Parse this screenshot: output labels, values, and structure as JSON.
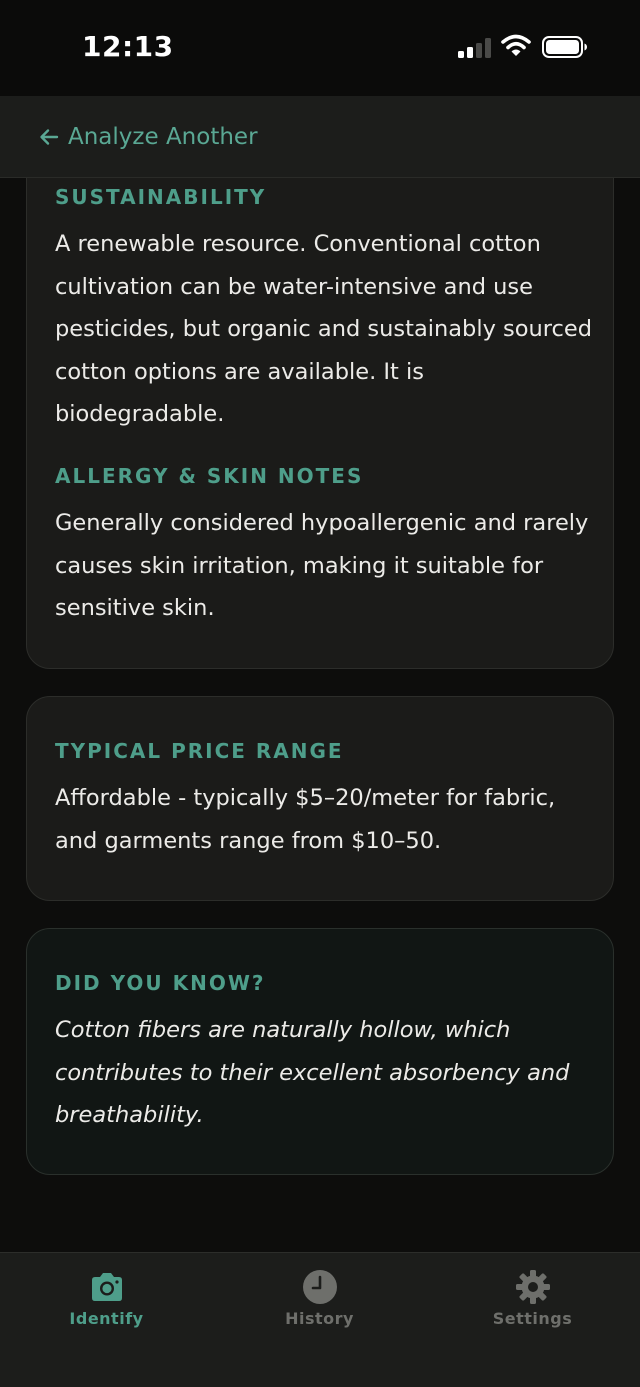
{
  "status_bar": {
    "time": "12:13"
  },
  "header": {
    "back_label": "Analyze Another"
  },
  "sections": {
    "sustainability": {
      "title": "SUSTAINABILITY",
      "lines": [
        "A renewable resource. Conventional cotton",
        "cultivation can be water-intensive and use",
        "pesticides, but organic and sustainably sourced",
        "cotton options are available. It is",
        "biodegradable."
      ]
    },
    "allergy": {
      "title": "ALLERGY & SKIN NOTES",
      "lines": [
        "Generally considered hypoallergenic and rarely",
        "causes skin irritation, making it suitable for",
        "sensitive skin."
      ]
    },
    "price": {
      "title": "TYPICAL PRICE RANGE",
      "lines": [
        "Affordable - typically $5–20/meter for fabric,",
        "and garments range from $10–50."
      ]
    },
    "fact": {
      "title": "DID YOU KNOW?",
      "lines": [
        "Cotton fibers are naturally hollow, which",
        "contributes to their excellent absorbency and",
        "breathability."
      ]
    }
  },
  "tabs": [
    {
      "label": "Identify",
      "icon": "camera-icon",
      "active": true
    },
    {
      "label": "History",
      "icon": "clock-icon",
      "active": false
    },
    {
      "label": "Settings",
      "icon": "gear-icon",
      "active": false
    }
  ],
  "colors": {
    "accent": "#5aa894",
    "tab_active": "#4e9e8a",
    "tab_inactive": "#6e6f6b",
    "card_bg": "#1b1b19",
    "fact_card_bg": "#111614",
    "page_bg": "#0d0d0c"
  }
}
